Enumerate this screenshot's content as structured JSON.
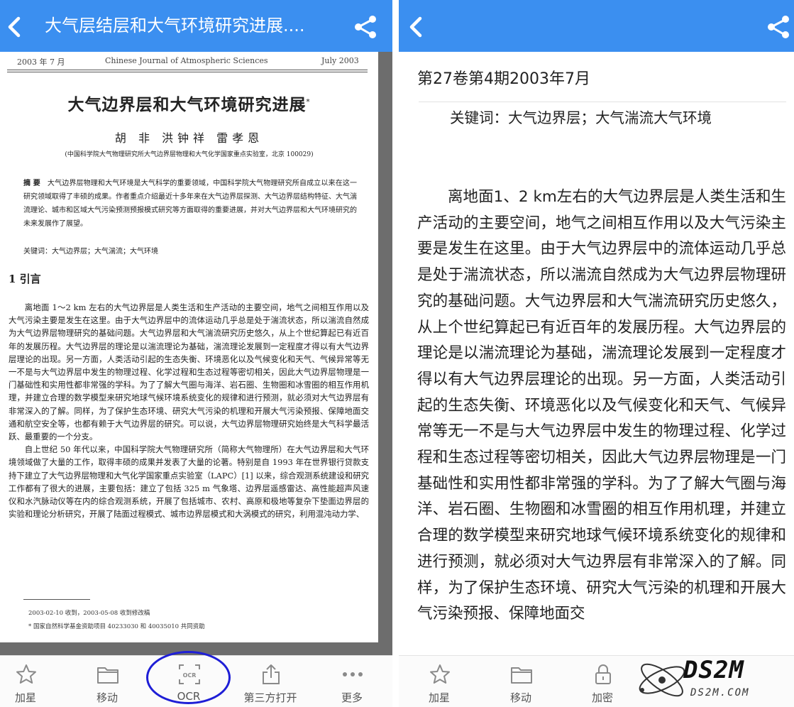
{
  "left": {
    "title": "大气层结层和大气环境研究进展....",
    "scan": {
      "running_left": "2003 年 7 月",
      "running_center": "Chinese Journal of Atmospheric Sciences",
      "running_right": "July   2003",
      "title": "大气边界层和大气环境研究进展",
      "title_mark": "*",
      "authors": "胡  非  洪钟祥  雷孝恩",
      "affiliation": "(中国科学院大气物理研究所大气边界层物理和大气化学国家重点实验室，北京  100029)",
      "abstract_label": "摘  要",
      "abstract": "大气边界层物理和大气环境是大气科学的重要领域，中国科学院大气物理研究所自成立以来在这一研究领域取得了丰硕的成果。作者重点介绍最近十多年来在大气边界层探测、大气边界层结构特征、大气湍流理论、城市和区域大气污染预测预报模式研究等方面取得的重要进展，并对大气边界层和大气环境研究的未来发展作了展望。",
      "keywords": "关键词：大气边界层；大气湍流；大气环境",
      "section": "1   引言",
      "para1": "离地面 1～2 km 左右的大气边界层是人类生活和生产活动的主要空间，地气之间相互作用以及大气污染主要是发生在这里。由于大气边界层中的流体运动几乎总是处于湍流状态，所以湍流自然成为大气边界层物理研究的基础问题。大气边界层和大气湍流研究历史悠久，从上个世纪算起已有近百年的发展历程。大气边界层的理论是以湍流理论为基础，湍流理论发展到一定程度才得以有大气边界层理论的出现。另一方面，人类活动引起的生态失衡、环境恶化以及气候变化和天气、气候异常等无一不是与大气边界层中发生的物理过程、化学过程和生态过程等密切相关，因此大气边界层物理是一门基础性和实用性都非常强的学科。为了了解大气圈与海洋、岩石圈、生物圈和冰雪圈的相互作用机理，并建立合理的数学模型来研究地球气候环境系统变化的规律和进行预测，就必须对大气边界层有非常深入的了解。同样，为了保护生态环境、研究大气污染的机理和开展大气污染预报、保障地面交通和航空安全等，也都有赖于大气边界层的研究。可以说，大气边界层物理研究始终是大气科学最活跃、最重要的一个分支。",
      "para2": "自上世纪 50 年代以来，中国科学院大气物理研究所（简称大气物理所）在大气边界层和大气环境领域做了大量的工作，取得丰硕的成果并发表了大量的论著。特别是自 1993 年在世界银行贷款支持下建立了大气边界层物理和大气化学国家重点实验室（LAPC）[1] 以来，综合观测系统建设和研究工作都有了很大的进展，主要包括：建立了包括 325 m 气象塔、边界层遥感雷达、高性能超声风速仪和水汽脉动仪等在内的综合观测系统，开展了包括城市、农村、高原和极地等复杂下垫面边界层的实验和理论分析研究，开展了陆面过程模式、城市边界层模式和大涡模式的研究，利用混沌动力学、",
      "footnote1": "2003-02-10 收到，2003-05-08 收到修改稿",
      "footnote2": "* 国家自然科学基金资助项目 40233030 和 40035010 共同资助"
    },
    "toolbar": [
      {
        "label": "加星",
        "icon": "star-icon"
      },
      {
        "label": "移动",
        "icon": "folder-icon"
      },
      {
        "label": "OCR",
        "icon": "ocr-icon"
      },
      {
        "label": "第三方打开",
        "icon": "open-external-icon"
      },
      {
        "label": "更多",
        "icon": "more-icon"
      }
    ]
  },
  "right": {
    "issue": "第27卷第4期2003年7月",
    "keywords": "关键词：大气边界层；大气湍流大气环境",
    "paragraph": "离地面1、2 km左右的大气边界层是人类生活和生产活动的主要空间，地气之间相互作用以及大气污染主要是发生在这里。由于大气边界层中的流体运动几乎总是处于湍流状态，所以湍流自然成为大气边界层物理研究的基础问题。大气边界层和大气湍流研究历史悠久，从上个世纪算起已有近百年的发展历程。大气边界层的理论是以湍流理论为基础，湍流理论发展到一定程度才得以有大气边界层理论的出现。另一方面，人类活动引起的生态失衡、环境恶化以及气候变化和天气、气候异常等无一不是与大气边界层中发生的物理过程、化学过程和生态过程等密切相关，因此大气边界层物理是一门基础性和实用性都非常强的学科。为了了解大气圈与海洋、岩石圈、生物圈和冰雪圈的相互作用机理，并建立合理的数学模型来研究地球气候环境系统变化的规律和进行预测，就必须对大气边界层有非常深入的了解。同样，为了保护生态环境、研究大气污染的机理和开展大气污染预报、保障地面交",
    "toolbar": [
      {
        "label": "加星",
        "icon": "star-icon"
      },
      {
        "label": "移动",
        "icon": "folder-icon"
      },
      {
        "label": "加密",
        "icon": "lock-icon"
      }
    ]
  },
  "watermark": {
    "text": "DS2M",
    "sub": "DS2M.COM"
  },
  "colors": {
    "topbar": "#3b8ff0",
    "highlight_ring": "#1e1ed6"
  }
}
